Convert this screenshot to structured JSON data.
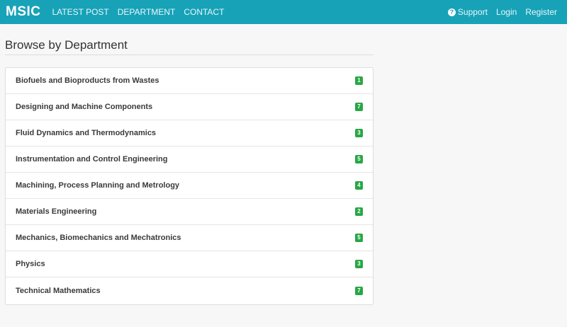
{
  "navbar": {
    "brand": "MSIC",
    "links": [
      "LATEST POST",
      "DEPARTMENT",
      "CONTACT"
    ],
    "support_label": "Support",
    "login_label": "Login",
    "register_label": "Register",
    "help_icon": "question-circle-icon",
    "color": "#17a2b8"
  },
  "main": {
    "title": "Browse by Department",
    "departments": [
      {
        "name": "Biofuels and Bioproducts from Wastes",
        "count": "1"
      },
      {
        "name": "Designing and Machine Components",
        "count": "7"
      },
      {
        "name": "Fluid Dynamics and Thermodynamics",
        "count": "3"
      },
      {
        "name": "Instrumentation and Control Engineering",
        "count": "5"
      },
      {
        "name": "Machining, Process Planning and Metrology",
        "count": "4"
      },
      {
        "name": "Materials Engineering",
        "count": "2"
      },
      {
        "name": "Mechanics, Biomechanics and Mechatronics",
        "count": "5"
      },
      {
        "name": "Physics",
        "count": "3"
      },
      {
        "name": "Technical Mathematics",
        "count": "7"
      }
    ],
    "badge_color": "#28a745"
  }
}
